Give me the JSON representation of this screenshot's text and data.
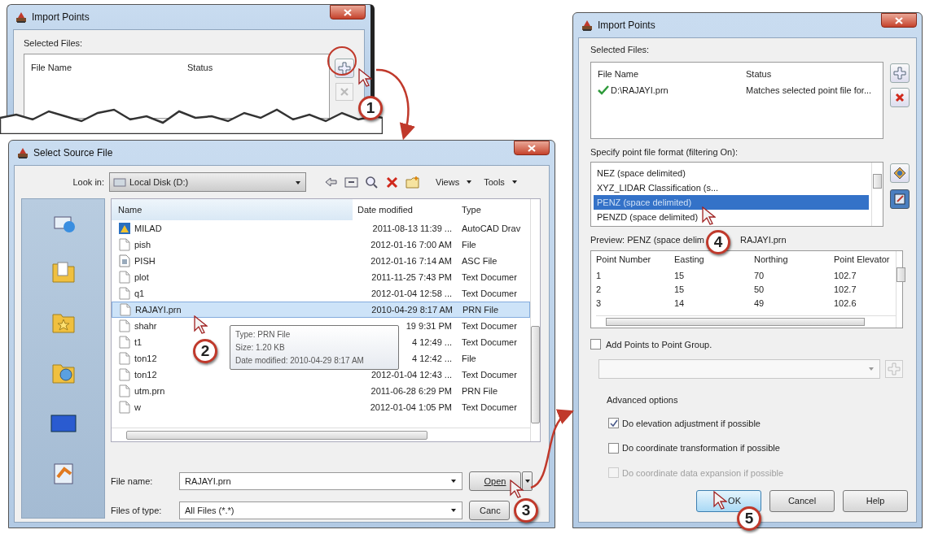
{
  "import_points_top": {
    "title": "Import Points",
    "selected_files_label": "Selected Files:",
    "columns": [
      "File Name",
      "Status"
    ]
  },
  "select_source_file": {
    "title": "Select Source File",
    "look_in_label": "Look in:",
    "look_in_value": "Local Disk (D:)",
    "menus": [
      "Views",
      "Tools"
    ],
    "columns": [
      "Name",
      "Date modified",
      "Type"
    ],
    "files": [
      {
        "name": "MILAD",
        "date": "2011-08-13 11:39 ...",
        "type": "AutoCAD Drav",
        "kind": "drawing",
        "selected": false
      },
      {
        "name": "pish",
        "date": "2012-01-16 7:00 AM",
        "type": "File",
        "kind": "file",
        "selected": false
      },
      {
        "name": "PISH",
        "date": "2012-01-16 7:14 AM",
        "type": "ASC File",
        "kind": "asc",
        "selected": false
      },
      {
        "name": "plot",
        "date": "2011-11-25 7:43 PM",
        "type": "Text Documer",
        "kind": "text",
        "selected": false
      },
      {
        "name": "q1",
        "date": "2012-01-04 12:58 ...",
        "type": "Text Documer",
        "kind": "text",
        "selected": false
      },
      {
        "name": "RAJAYI.prn",
        "date": "2010-04-29 8:17 AM",
        "type": "PRN File",
        "kind": "text",
        "selected": true
      },
      {
        "name": "shahr",
        "date": "19 9:31 PM",
        "type": "Text Documer",
        "kind": "text",
        "selected": false
      },
      {
        "name": "t1",
        "date": "4 12:49 ...",
        "type": "Text Documer",
        "kind": "text",
        "selected": false
      },
      {
        "name": "ton12",
        "date": "4 12:42 ...",
        "type": "File",
        "kind": "file",
        "selected": false
      },
      {
        "name": "ton12",
        "date": "2012-01-04 12:43 ...",
        "type": "Text Documer",
        "kind": "text",
        "selected": false
      },
      {
        "name": "utm.prn",
        "date": "2011-06-28 6:29 PM",
        "type": "PRN File",
        "kind": "text",
        "selected": false
      },
      {
        "name": "w",
        "date": "2012-01-04 1:05 PM",
        "type": "Text Documer",
        "kind": "text",
        "selected": false
      }
    ],
    "tooltip": [
      "Type: PRN File",
      "Size: 1.20 KB",
      "Date modified: 2010-04-29 8:17 AM"
    ],
    "file_name_label": "File name:",
    "file_name_value": "RAJAYI.prn",
    "file_type_label": "Files of type:",
    "file_type_value": "All Files (*.*)",
    "open_button": "Open",
    "cancel_button": "Canc"
  },
  "import_points": {
    "title": "Import Points",
    "selected_files_label": "Selected Files:",
    "columns": [
      "File Name",
      "Status"
    ],
    "files": [
      {
        "name": "D:\\RAJAYI.prn",
        "status": "Matches selected point file for...",
        "valid": true
      }
    ],
    "format_label": "Specify point file format (filtering On):",
    "formats": [
      {
        "label": "NEZ (space delimited)",
        "selected": false
      },
      {
        "label": "XYZ_LIDAR Classification (s...",
        "selected": false
      },
      {
        "label": "PENZ (space delimited)",
        "selected": true
      },
      {
        "label": "PENZD (space delimited)",
        "selected": false
      }
    ],
    "preview_label": "Preview: PENZ (space delim",
    "preview_file": "RAJAYI.prn",
    "preview_columns": [
      "Point Number",
      "Easting",
      "Northing",
      "Point Elevator"
    ],
    "preview_rows": [
      [
        "1",
        "15",
        "70",
        "102.7"
      ],
      [
        "2",
        "15",
        "50",
        "102.7"
      ],
      [
        "3",
        "14",
        "49",
        "102.6"
      ]
    ],
    "add_to_group": {
      "label": "Add Points to Point Group.",
      "checked": false
    },
    "advanced_label": "Advanced options",
    "options": [
      {
        "label": "Do elevation adjustment if possible",
        "checked": true,
        "disabled": false
      },
      {
        "label": "Do coordinate transformation if possible",
        "checked": false,
        "disabled": false
      },
      {
        "label": "Do coordinate data expansion if possible",
        "checked": false,
        "disabled": true
      }
    ],
    "buttons": [
      "OK",
      "Cancel",
      "Help"
    ]
  },
  "callouts": [
    "1",
    "2",
    "3",
    "4",
    "5"
  ]
}
